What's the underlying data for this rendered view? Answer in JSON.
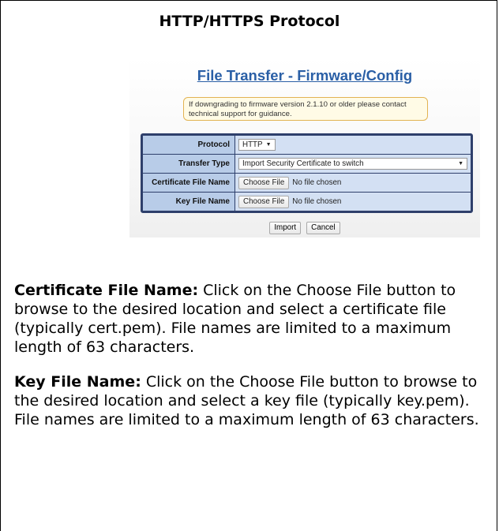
{
  "heading": "HTTP/HTTPS Protocol",
  "screenshot": {
    "title": "File Transfer - Firmware/Config",
    "note": "If downgrading to firmware version 2.1.10 or older please contact technical support for guidance.",
    "rows": [
      {
        "label": "Protocol",
        "value": "HTTP"
      },
      {
        "label": "Transfer Type",
        "value": "Import Security Certificate to switch"
      },
      {
        "label": "Certificate File Name",
        "button": "Choose File",
        "status": "No file chosen"
      },
      {
        "label": "Key File Name",
        "button": "Choose File",
        "status": "No file chosen"
      }
    ],
    "import_label": "Import",
    "cancel_label": "Cancel"
  },
  "paragraphs": [
    {
      "term": "Certificate File Name:",
      "text": " Click on the Choose File button to browse to the desired location and select a certificate file (typically cert.pem). File names are limited to a maximum length of 63 characters."
    },
    {
      "term": "Key File Name:",
      "text": " Click on the Choose File button to browse to the desired location and select a key file (typically key.pem). File names are limited to a maximum length of 63 characters."
    }
  ]
}
